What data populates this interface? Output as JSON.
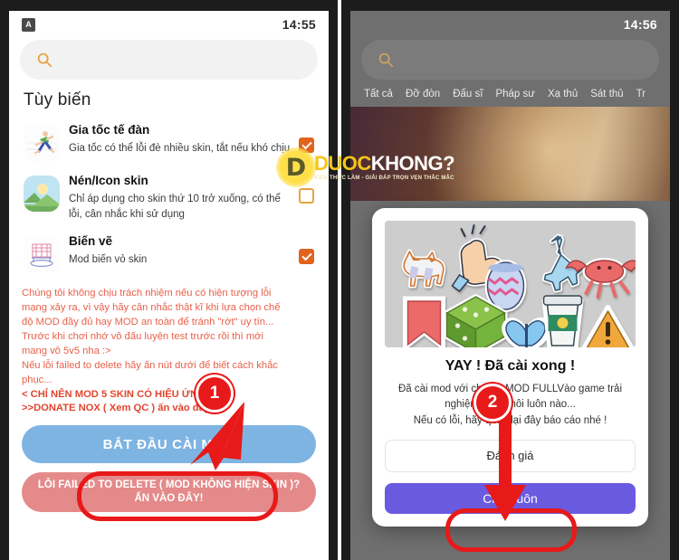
{
  "left_phone": {
    "status": {
      "app_icon": "app-badge-icon",
      "app_icon_glyph": "A",
      "time": "14:55"
    },
    "search": {
      "icon": "search-icon",
      "placeholder": ""
    },
    "section_title": "Tùy biến",
    "items": [
      {
        "icon": "running-man-icon",
        "title": "Gia tốc tế đàn",
        "desc": "Gia tốc có thể lỗi đè nhiều skin, tắt nếu khó chịu",
        "checked": true
      },
      {
        "icon": "image-landscape-icon",
        "title": "Nén/Icon skin",
        "desc": "Chỉ áp dụng cho skin thứ 10 trở xuống, có thể lỗi, cân nhắc khi sử dụng",
        "checked": false
      },
      {
        "icon": "bridge-sketch-icon",
        "title": "Biến vẽ",
        "desc": "Mod biến vỏ skin",
        "checked": true
      }
    ],
    "warning_lines": [
      "Chúng tôi không chịu trách nhiệm nếu có hiện tượng lỗi",
      "mạng xảy ra, vì vậy hãy cân nhắc thật kĩ khi lựa chọn chế",
      "độ MOD đầy đủ hay MOD an toàn để tránh \"rớt\" uy tín...",
      "Trước khi chơi nhớ vô đấu luyện test trước rồi thì mới",
      "mang vô 5v5 nha :>",
      "Nếu lỗi failed to delete hãy ấn nút dưới để biết cách khắc",
      "phục..."
    ],
    "warning_strong_lines": [
      "< CHỈ NÊN MOD 5 SKIN CÓ HIỆU ỨNG >",
      ">>DONATE NOX ( Xem QC ) ấn vào đây <<"
    ],
    "primary_button": "BẮT ĐẦU CÀI MOD",
    "secondary_button": "LỖI FAILED TO DELETE ( MOD KHÔNG HIỆN SKIN )? ẤN VÀO ĐÂY!"
  },
  "right_phone": {
    "status": {
      "time": "14:56"
    },
    "search": {
      "icon": "search-icon"
    },
    "tabs": [
      "Tất cả",
      "Đỡ đòn",
      "Đấu sĩ",
      "Pháp sư",
      "Xạ thủ",
      "Sát thủ",
      "Tr"
    ],
    "dialog": {
      "art": "stickers-illustration",
      "heading": "YAY ! Đã cài xong !",
      "body_lines": [
        "Đã cài mod với chế độ MOD FULLVào game trải",
        "nghiệm ngay thôi luôn nào...",
        "Nếu có lỗi, hãy quay lại đây báo cáo nhé !"
      ],
      "ghost_button": "Đánh giá",
      "primary_button": "Chơi luôn"
    }
  },
  "watermark": {
    "badge_letter": "D",
    "text_yellow": "DUOC",
    "text_white": "KHONG?",
    "tagline": "KIẾN THỨC LÀM - GIẢI ĐÁP TRỌN VẸN THẮC MẮC"
  },
  "annotations": {
    "markers": [
      {
        "label": "1",
        "target": "bat-dau-cai-mod-button"
      },
      {
        "label": "2",
        "target": "choi-luon-button"
      }
    ],
    "highlight_color": "#e81919"
  },
  "colors": {
    "checkbox_on": "#e2631c",
    "checkbox_off_border": "#e8a33d",
    "primary_blue": "#7eb4e2",
    "secondary_pink": "#e48a8a",
    "dialog_primary": "#6a5ae0",
    "warning_text": "#e8604a",
    "annotation_red": "#e81919"
  }
}
